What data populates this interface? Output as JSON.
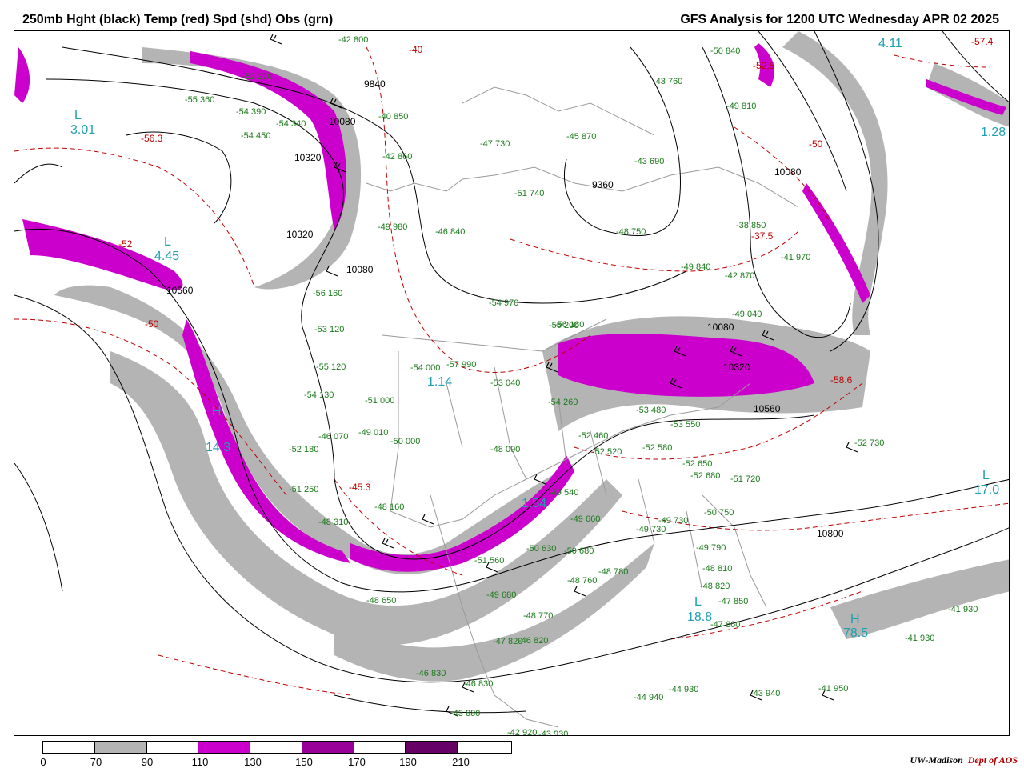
{
  "header": {
    "title_left": "250mb Hght (black) Temp (red) Spd (shd) Obs (grn)",
    "title_right": "GFS Analysis for 1200 UTC Wednesday  APR 02 2025"
  },
  "colors": {
    "height_contour": "#000000",
    "temperature_contour": "#c00000",
    "observations": "#1a7a1a",
    "centers": "#1fa0b0",
    "speed_70_90": "#b4b4b4",
    "speed_110_130": "#cc00cc",
    "speed_150_170": "#990099",
    "speed_190_210": "#660066",
    "borders": "#9a9a9a"
  },
  "legend": {
    "labels": [
      "0",
      "70",
      "90",
      "110",
      "130",
      "150",
      "170",
      "190",
      "210"
    ],
    "segments": [
      {
        "from": "0",
        "to": "70",
        "color": "#ffffff"
      },
      {
        "from": "70",
        "to": "90",
        "color": "#b4b4b4"
      },
      {
        "from": "90",
        "to": "110",
        "color": "#ffffff"
      },
      {
        "from": "110",
        "to": "130",
        "color": "#cc00cc"
      },
      {
        "from": "130",
        "to": "150",
        "color": "#ffffff"
      },
      {
        "from": "150",
        "to": "170",
        "color": "#990099"
      },
      {
        "from": "170",
        "to": "190",
        "color": "#ffffff"
      },
      {
        "from": "190",
        "to": "210",
        "color": "#660066"
      }
    ]
  },
  "credit": {
    "institution": "UW-Madison",
    "department": "Dept of AOS"
  },
  "height_labels": [
    "9840",
    "10080",
    "10320",
    "10320",
    "10080",
    "10560",
    "9360",
    "10080",
    "10080",
    "10320",
    "10560",
    "10800"
  ],
  "temp_labels": [
    "-40",
    "-56.3",
    "-50",
    "-52",
    "-58.6",
    "-45.3",
    "-50",
    "-57.4",
    "-52.5",
    "-37.5"
  ],
  "centers": [
    {
      "type": "L",
      "value": "3.01"
    },
    {
      "type": "L",
      "value": "4.45"
    },
    {
      "type": "H",
      "value": "14.3"
    },
    {
      "type": "L",
      "value": "17.0"
    },
    {
      "type": "L",
      "value": "18.8"
    },
    {
      "type": "H",
      "value": "78.5"
    },
    {
      "type": "H",
      "value": "1.54"
    },
    {
      "type": "L",
      "value": "1.14"
    },
    {
      "type": "H",
      "value": "1.28"
    },
    {
      "type": "L",
      "value": "4.11"
    }
  ],
  "observations": [
    "-42 800",
    "-40 850",
    "-42 860",
    "-47 730",
    "-45 870",
    "-43 760",
    "-50 840",
    "-49 810",
    "-43 690",
    "-51 740",
    "-46 840",
    "-49 980",
    "-48 750",
    "-38 850",
    "-41 970",
    "-49 840",
    "-42 870",
    "-49 040",
    "-54 970",
    "-56 180",
    "-56 160",
    "-53 120",
    "-55 120",
    "-54 130",
    "-51 000",
    "-49 010",
    "-50 000",
    "-48 090",
    "-53 040",
    "-54 000",
    "-57 990",
    "-54 260",
    "-53 480",
    "-52 460",
    "-52 520",
    "-52 580",
    "-52 650",
    "-52 680",
    "-52 730",
    "-51 720",
    "-50 750",
    "-49 790",
    "-48 810",
    "-48 820",
    "-47 850",
    "-47 860",
    "-48 780",
    "-48 760",
    "-48 770",
    "-47 820",
    "-46 820",
    "-46 830",
    "-46 830",
    "-43 880",
    "-42 920",
    "-43 930",
    "-44 940",
    "-44 930",
    "-43 940",
    "-41 950",
    "-41 930",
    "-41 930",
    "-49 730",
    "-49 730",
    "-50 680",
    "-50 630",
    "-51 560",
    "-49 680",
    "-49 660",
    "-48 650",
    "-48 160",
    "-48 310",
    "-51 250",
    "-46 070",
    "-52 180",
    "-55 360",
    "-54 390",
    "-54 340",
    "-54 450",
    "-52 270",
    "-49 540",
    "-53 550",
    "-55 200"
  ]
}
